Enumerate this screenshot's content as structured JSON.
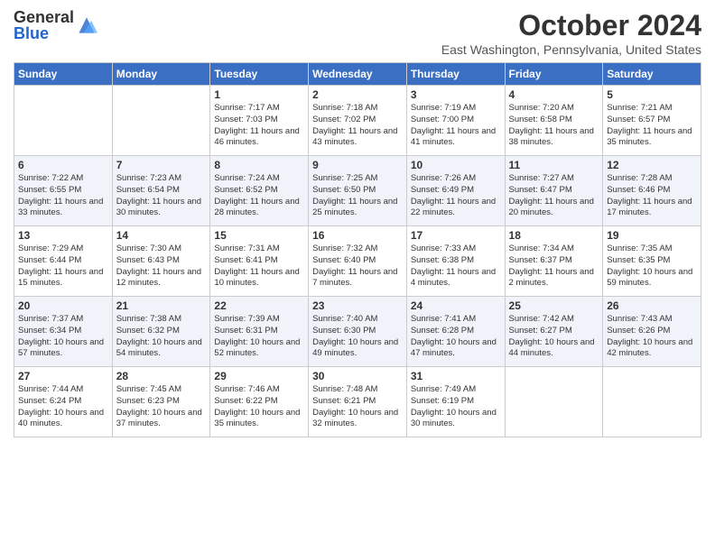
{
  "logo": {
    "general": "General",
    "blue": "Blue"
  },
  "title": "October 2024",
  "location": "East Washington, Pennsylvania, United States",
  "days_of_week": [
    "Sunday",
    "Monday",
    "Tuesday",
    "Wednesday",
    "Thursday",
    "Friday",
    "Saturday"
  ],
  "weeks": [
    [
      {
        "day": "",
        "info": ""
      },
      {
        "day": "",
        "info": ""
      },
      {
        "day": "1",
        "info": "Sunrise: 7:17 AM\nSunset: 7:03 PM\nDaylight: 11 hours and 46 minutes."
      },
      {
        "day": "2",
        "info": "Sunrise: 7:18 AM\nSunset: 7:02 PM\nDaylight: 11 hours and 43 minutes."
      },
      {
        "day": "3",
        "info": "Sunrise: 7:19 AM\nSunset: 7:00 PM\nDaylight: 11 hours and 41 minutes."
      },
      {
        "day": "4",
        "info": "Sunrise: 7:20 AM\nSunset: 6:58 PM\nDaylight: 11 hours and 38 minutes."
      },
      {
        "day": "5",
        "info": "Sunrise: 7:21 AM\nSunset: 6:57 PM\nDaylight: 11 hours and 35 minutes."
      }
    ],
    [
      {
        "day": "6",
        "info": "Sunrise: 7:22 AM\nSunset: 6:55 PM\nDaylight: 11 hours and 33 minutes."
      },
      {
        "day": "7",
        "info": "Sunrise: 7:23 AM\nSunset: 6:54 PM\nDaylight: 11 hours and 30 minutes."
      },
      {
        "day": "8",
        "info": "Sunrise: 7:24 AM\nSunset: 6:52 PM\nDaylight: 11 hours and 28 minutes."
      },
      {
        "day": "9",
        "info": "Sunrise: 7:25 AM\nSunset: 6:50 PM\nDaylight: 11 hours and 25 minutes."
      },
      {
        "day": "10",
        "info": "Sunrise: 7:26 AM\nSunset: 6:49 PM\nDaylight: 11 hours and 22 minutes."
      },
      {
        "day": "11",
        "info": "Sunrise: 7:27 AM\nSunset: 6:47 PM\nDaylight: 11 hours and 20 minutes."
      },
      {
        "day": "12",
        "info": "Sunrise: 7:28 AM\nSunset: 6:46 PM\nDaylight: 11 hours and 17 minutes."
      }
    ],
    [
      {
        "day": "13",
        "info": "Sunrise: 7:29 AM\nSunset: 6:44 PM\nDaylight: 11 hours and 15 minutes."
      },
      {
        "day": "14",
        "info": "Sunrise: 7:30 AM\nSunset: 6:43 PM\nDaylight: 11 hours and 12 minutes."
      },
      {
        "day": "15",
        "info": "Sunrise: 7:31 AM\nSunset: 6:41 PM\nDaylight: 11 hours and 10 minutes."
      },
      {
        "day": "16",
        "info": "Sunrise: 7:32 AM\nSunset: 6:40 PM\nDaylight: 11 hours and 7 minutes."
      },
      {
        "day": "17",
        "info": "Sunrise: 7:33 AM\nSunset: 6:38 PM\nDaylight: 11 hours and 4 minutes."
      },
      {
        "day": "18",
        "info": "Sunrise: 7:34 AM\nSunset: 6:37 PM\nDaylight: 11 hours and 2 minutes."
      },
      {
        "day": "19",
        "info": "Sunrise: 7:35 AM\nSunset: 6:35 PM\nDaylight: 10 hours and 59 minutes."
      }
    ],
    [
      {
        "day": "20",
        "info": "Sunrise: 7:37 AM\nSunset: 6:34 PM\nDaylight: 10 hours and 57 minutes."
      },
      {
        "day": "21",
        "info": "Sunrise: 7:38 AM\nSunset: 6:32 PM\nDaylight: 10 hours and 54 minutes."
      },
      {
        "day": "22",
        "info": "Sunrise: 7:39 AM\nSunset: 6:31 PM\nDaylight: 10 hours and 52 minutes."
      },
      {
        "day": "23",
        "info": "Sunrise: 7:40 AM\nSunset: 6:30 PM\nDaylight: 10 hours and 49 minutes."
      },
      {
        "day": "24",
        "info": "Sunrise: 7:41 AM\nSunset: 6:28 PM\nDaylight: 10 hours and 47 minutes."
      },
      {
        "day": "25",
        "info": "Sunrise: 7:42 AM\nSunset: 6:27 PM\nDaylight: 10 hours and 44 minutes."
      },
      {
        "day": "26",
        "info": "Sunrise: 7:43 AM\nSunset: 6:26 PM\nDaylight: 10 hours and 42 minutes."
      }
    ],
    [
      {
        "day": "27",
        "info": "Sunrise: 7:44 AM\nSunset: 6:24 PM\nDaylight: 10 hours and 40 minutes."
      },
      {
        "day": "28",
        "info": "Sunrise: 7:45 AM\nSunset: 6:23 PM\nDaylight: 10 hours and 37 minutes."
      },
      {
        "day": "29",
        "info": "Sunrise: 7:46 AM\nSunset: 6:22 PM\nDaylight: 10 hours and 35 minutes."
      },
      {
        "day": "30",
        "info": "Sunrise: 7:48 AM\nSunset: 6:21 PM\nDaylight: 10 hours and 32 minutes."
      },
      {
        "day": "31",
        "info": "Sunrise: 7:49 AM\nSunset: 6:19 PM\nDaylight: 10 hours and 30 minutes."
      },
      {
        "day": "",
        "info": ""
      },
      {
        "day": "",
        "info": ""
      }
    ]
  ]
}
